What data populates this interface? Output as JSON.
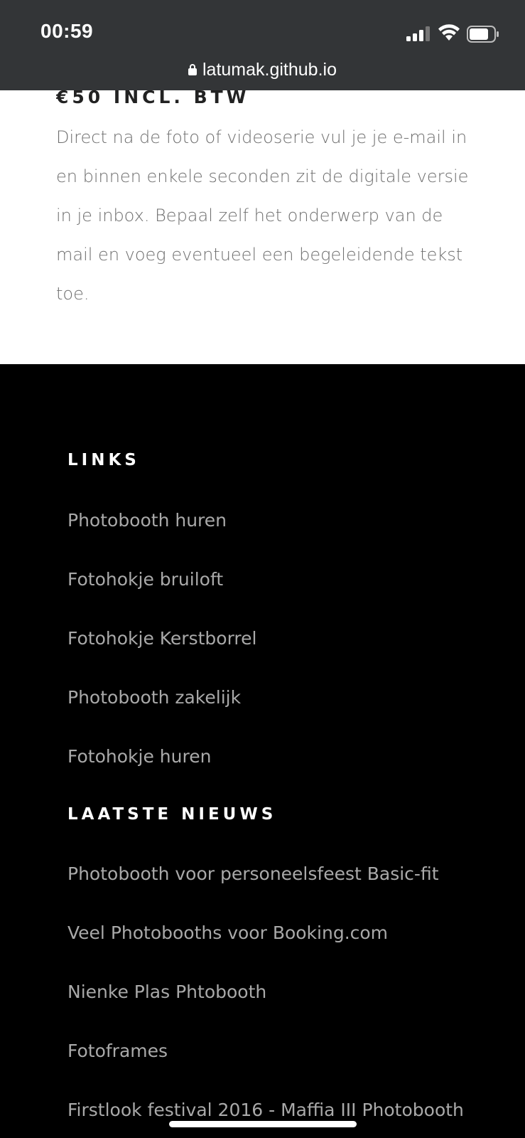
{
  "status_bar": {
    "time": "00:59"
  },
  "browser": {
    "url": "latumak.github.io"
  },
  "content": {
    "price_heading": "€50 INCL. BTW",
    "description": "Direct na de foto of videoserie vul je je e-mail in en binnen enkele seconden zit de digitale versie in je inbox. Bepaal zelf het onderwerp van de mail en voeg eventueel een begeleidende tekst toe."
  },
  "footer": {
    "links_heading": "LINKS",
    "links": [
      {
        "label": "Photobooth huren"
      },
      {
        "label": "Fotohokje bruiloft"
      },
      {
        "label": "Fotohokje Kerstborrel"
      },
      {
        "label": "Photobooth zakelijk"
      },
      {
        "label": "Fotohokje huren"
      }
    ],
    "news_heading": "LAATSTE NIEUWS",
    "news": [
      {
        "label": "Photobooth voor personeelsfeest Basic-fit"
      },
      {
        "label": "Veel Photobooths voor Booking.com"
      },
      {
        "label": "Nienke Plas Phtobooth"
      },
      {
        "label": "Fotoframes"
      },
      {
        "label": "Firstlook festival 2016 - Maffia III Photobooth"
      }
    ]
  },
  "colors": {
    "chrome_bg": "#333537",
    "footer_bg": "#000000",
    "footer_link": "#a9a9a9",
    "body_text": "#6f6f6f"
  },
  "icons": [
    "signal-icon",
    "wifi-icon",
    "battery-icon",
    "lock-icon"
  ]
}
